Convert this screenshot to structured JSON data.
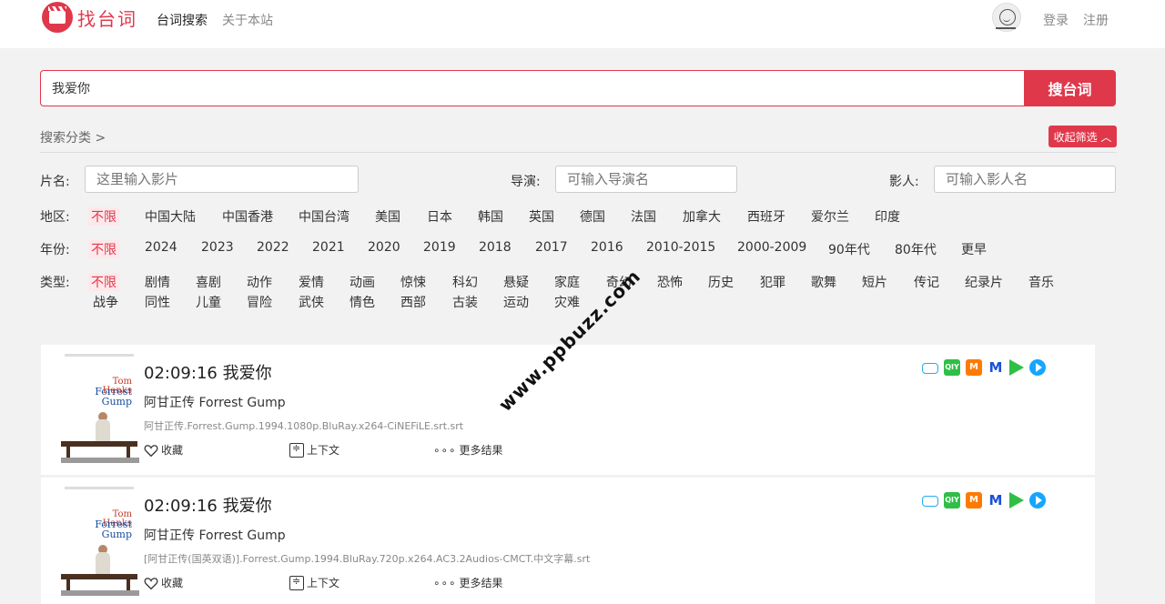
{
  "header": {
    "logo_text": "找台词",
    "nav": [
      "台词搜索",
      "关于本站"
    ],
    "login": "登录",
    "register": "注册"
  },
  "search": {
    "value": "我爱你",
    "button": "搜台词"
  },
  "filters": {
    "category_title": "搜索分类 >",
    "collapse": "收起筛选 ︿",
    "movie_label": "片名:",
    "movie_placeholder": "这里输入影片",
    "director_label": "导演:",
    "director_placeholder": "可输入导演名",
    "actor_label": "影人:",
    "actor_placeholder": "可输入影人名",
    "region_label": "地区:",
    "regions": [
      "不限",
      "中国大陆",
      "中国香港",
      "中国台湾",
      "美国",
      "日本",
      "韩国",
      "英国",
      "德国",
      "法国",
      "加拿大",
      "西班牙",
      "爱尔兰",
      "印度"
    ],
    "year_label": "年份:",
    "years": [
      "不限",
      "2024",
      "2023",
      "2022",
      "2021",
      "2020",
      "2019",
      "2018",
      "2017",
      "2016",
      "2010-2015",
      "2000-2009",
      "90年代",
      "80年代",
      "更早"
    ],
    "genre_label": "类型:",
    "genres_row1": [
      "不限",
      "剧情",
      "喜剧",
      "动作",
      "爱情",
      "动画",
      "惊悚",
      "科幻",
      "悬疑",
      "家庭",
      "奇幻",
      "恐怖",
      "历史",
      "犯罪",
      "歌舞",
      "短片",
      "传记",
      "纪录片",
      "音乐"
    ],
    "genres_row2": [
      "战争",
      "同性",
      "儿童",
      "冒险",
      "武侠",
      "情色",
      "西部",
      "古装",
      "运动",
      "灾难"
    ]
  },
  "results": [
    {
      "time": "02:09:16 我爱你",
      "movie": "阿甘正传 Forrest Gump",
      "file": "阿甘正传.Forrest.Gump.1994.1080p.BluRay.x264-CiNEFiLE.srt.srt",
      "poster_name": "Tom Hanks",
      "poster_title": "Forrest Gump",
      "favorite": "收藏",
      "context": "上下文",
      "more": "更多结果"
    },
    {
      "time": "02:09:16 我爱你",
      "movie": "阿甘正传 Forrest Gump",
      "file": "[阿甘正传(国英双语)].Forrest.Gump.1994.BluRay.720p.x264.AC3.2Audios-CMCT.中文字幕.srt",
      "poster_name": "Tom Hanks",
      "poster_title": "Forrest Gump",
      "favorite": "收藏",
      "context": "上下文",
      "more": "更多结果"
    }
  ],
  "platform_icons": [
    "bilibili-icon",
    "iqiyi-icon",
    "mgtv-icon",
    "migu-icon",
    "play-icon",
    "tencent-video-icon"
  ],
  "platform_labels": {
    "iqiyi": "QIY",
    "mgtv": "M",
    "migu": "M"
  },
  "watermark": "www.ppbuzz.com",
  "colors": {
    "accent": "#e0384b",
    "background": "#f2f2f2"
  }
}
